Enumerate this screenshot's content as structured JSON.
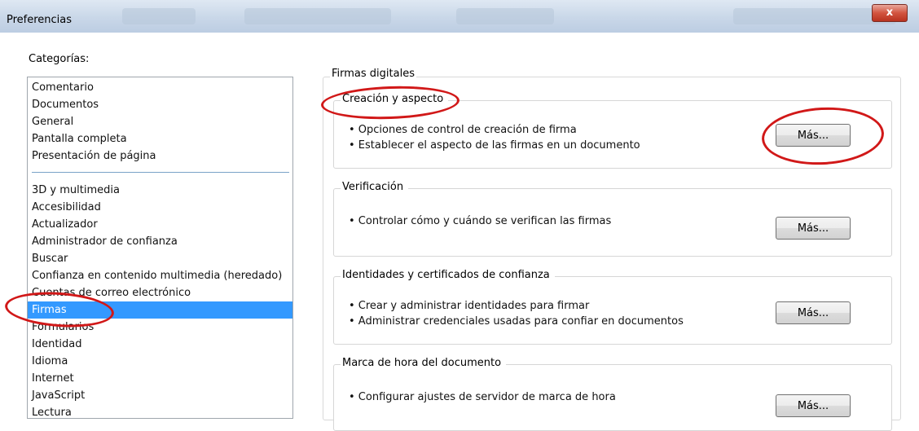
{
  "window": {
    "title": "Preferencias",
    "close_glyph": "x"
  },
  "categories": {
    "label": "Categorías:",
    "top_items": [
      "Comentario",
      "Documentos",
      "General",
      "Pantalla completa",
      "Presentación de página"
    ],
    "items": [
      "3D y multimedia",
      "Accesibilidad",
      "Actualizador",
      "Administrador de confianza",
      "Buscar",
      "Confianza en contenido multimedia (heredado)",
      "Cuentas de correo electrónico",
      "Firmas",
      "Formularios",
      "Identidad",
      "Idioma",
      "Internet",
      "JavaScript",
      "Lectura"
    ],
    "selected": "Firmas"
  },
  "panel": {
    "title": "Firmas digitales",
    "groups": [
      {
        "title": "Creación y aspecto",
        "bullets": [
          "• Opciones de control de creación de firma",
          "• Establecer el aspecto de las firmas en un documento"
        ],
        "button": "Más..."
      },
      {
        "title": "Verificación",
        "bullets": [
          "• Controlar cómo y cuándo se verifican las firmas"
        ],
        "button": "Más..."
      },
      {
        "title": "Identidades y certificados de confianza",
        "bullets": [
          "• Crear y administrar identidades para firmar",
          "• Administrar credenciales usadas para confiar en documentos"
        ],
        "button": "Más..."
      },
      {
        "title": "Marca de hora del documento",
        "bullets": [
          "• Configurar ajustes de servidor de marca de hora"
        ],
        "button": "Más..."
      }
    ]
  },
  "colors": {
    "selection": "#3399ff",
    "annotation": "#d11818"
  }
}
